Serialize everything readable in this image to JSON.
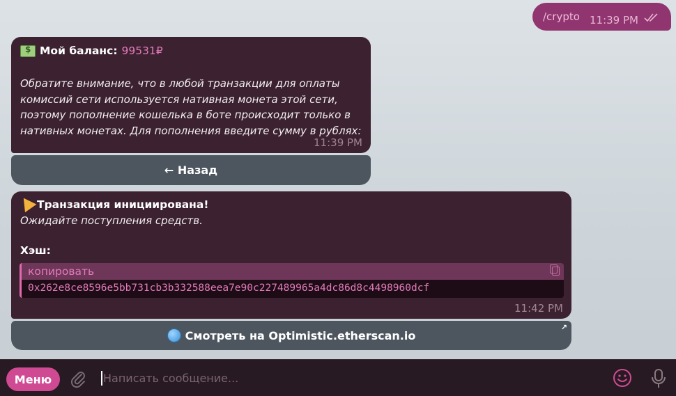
{
  "outgoing": {
    "text": "/crypto",
    "time": "11:39 PM"
  },
  "message1": {
    "title": "Мой баланс:",
    "balance": "99531₽",
    "note": "Обратите внимание, что в любой транзакции для оплаты комиссий сети используется нативная монета этой сети, поэтому пополнение кошелька в боте происходит только в нативных монетах. Для пополнения введите сумму в рублях:",
    "time": "11:39 PM",
    "icon": "money-icon"
  },
  "button_back": {
    "label": "← Назад"
  },
  "message2": {
    "title": "Транзакция инициирована!",
    "subtitle": "Ожидайте поступления средств.",
    "hash_label": "Хэш:",
    "copy_label": "копировать",
    "hash": "0x262e8ce8596e5bb731cb3b332588eea7e90c227489965a4dc86d8c4498960dcf",
    "time": "11:42 PM",
    "icon": "party-popper-icon"
  },
  "button_explorer": {
    "label": "Смотреть на Optimistic.etherscan.io",
    "icon": "globe-icon"
  },
  "input_bar": {
    "menu_label": "Меню",
    "placeholder": "Написать сообщение..."
  },
  "colors": {
    "accent": "#d04a93",
    "bubble_in": "#3c2131",
    "bubble_out": "#90356f",
    "button": "#4d565f"
  }
}
